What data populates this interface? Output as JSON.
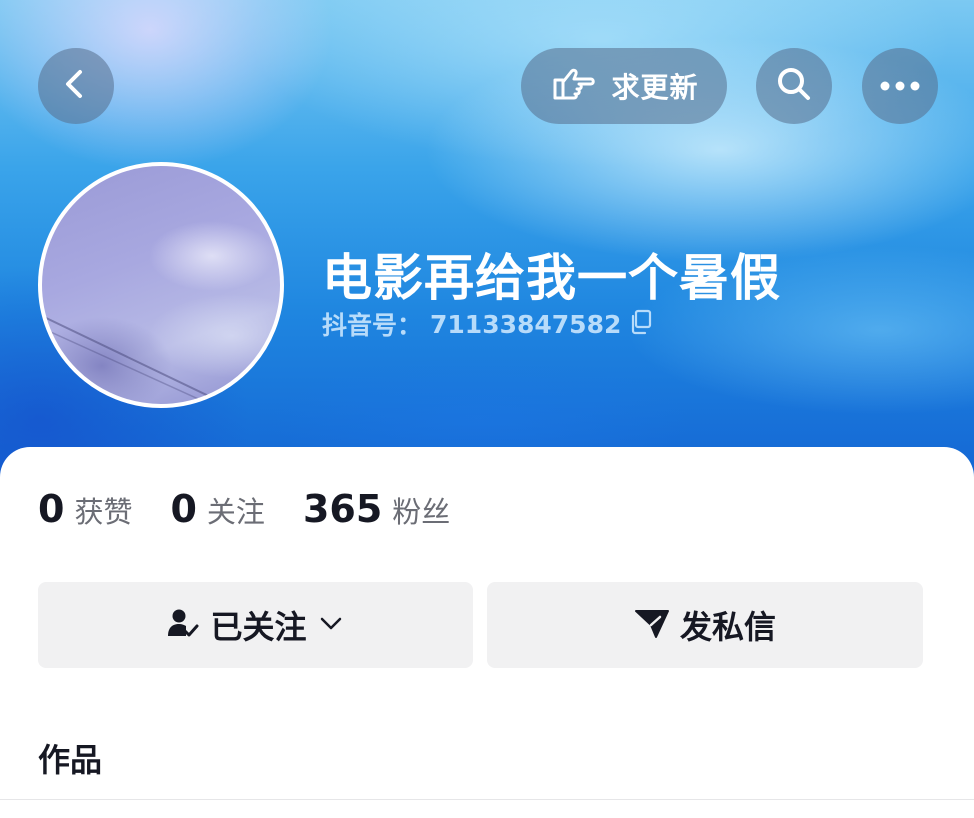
{
  "header": {
    "update_label": "求更新"
  },
  "profile": {
    "name": "电影再给我一个暑假",
    "id_label": "抖音号：",
    "id_value": "71133847582"
  },
  "stats": [
    {
      "count": "0",
      "label": "获赞"
    },
    {
      "count": "0",
      "label": "关注"
    },
    {
      "count": "365",
      "label": "粉丝"
    }
  ],
  "actions": {
    "follow_label": "已关注",
    "message_label": "发私信"
  },
  "tabs": {
    "works_label": "作品"
  },
  "icons": {
    "back": "chevron-left-icon",
    "update": "pointing-hand-icon",
    "search": "search-icon",
    "more": "more-dots-icon",
    "copy": "copy-icon",
    "followed": "user-check-icon",
    "dropdown": "chevron-down-icon",
    "message": "paper-plane-icon"
  },
  "colors": {
    "text_primary": "#161823",
    "text_secondary": "#6b6d75",
    "button_bg": "#f1f1f2"
  }
}
